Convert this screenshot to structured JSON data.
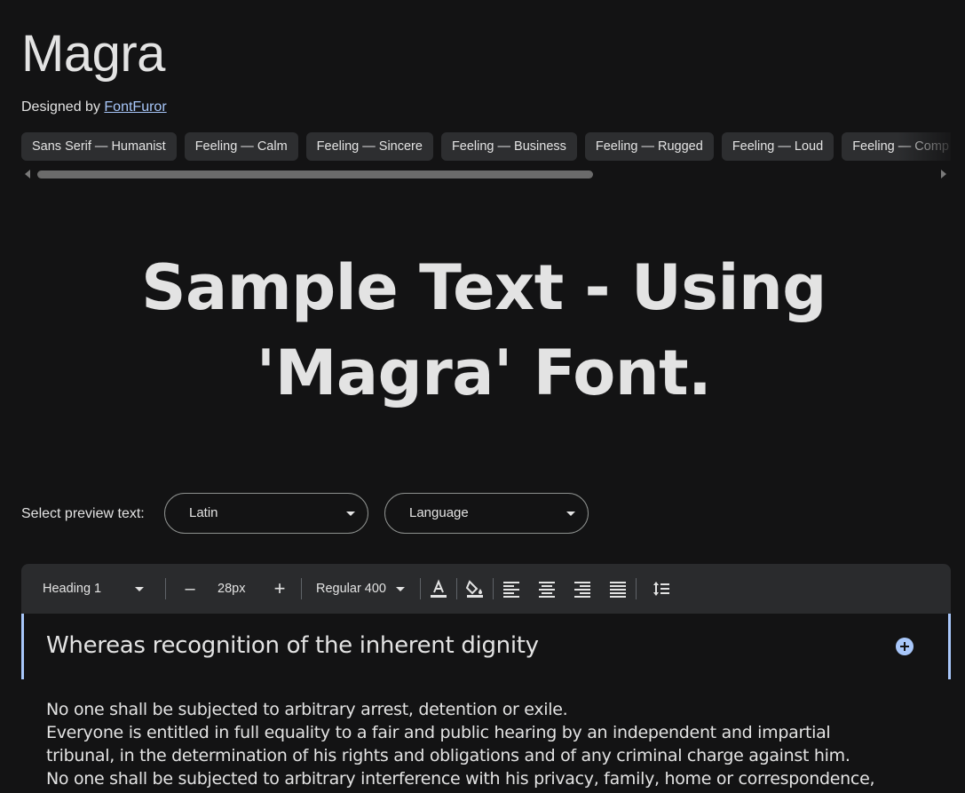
{
  "font": {
    "name": "Magra",
    "designed_by_label": "Designed by",
    "designer": "FontFuror"
  },
  "tags": [
    "Sans Serif — Humanist",
    "Feeling — Calm",
    "Feeling — Sincere",
    "Feeling — Business",
    "Feeling — Rugged",
    "Feeling — Loud",
    "Feeling — Comp"
  ],
  "sample_text": "Sample Text - Using 'Magra' Font.",
  "preview": {
    "label": "Select preview text:",
    "script_value": "Latin",
    "language_value": "Language"
  },
  "toolbar": {
    "style_value": "Heading 1",
    "size_value": "28px",
    "weight_value": "Regular 400",
    "decrease_glyph": "–",
    "increase_glyph": "+"
  },
  "editor": {
    "heading_text": "Whereas recognition of the inherent dignity",
    "body_lines": [
      "No one shall be subjected to arbitrary arrest, detention or exile.",
      "Everyone is entitled in full equality to a fair and public hearing by an independent and impartial",
      "tribunal, in the determination of his rights and obligations and of any criminal charge against him.",
      "No one shall be subjected to arbitrary interference with his privacy, family, home or correspondence,"
    ]
  },
  "colors": {
    "background": "#131314",
    "accent": "#a8c7fa",
    "chip_bg": "#2d2e30",
    "toolbar_bg": "#2a2b2d"
  },
  "icons": [
    "text-color-icon",
    "highlight-color-icon",
    "align-left-icon",
    "align-center-icon",
    "align-right-icon",
    "align-justify-icon",
    "line-height-icon",
    "add-circle-icon"
  ]
}
